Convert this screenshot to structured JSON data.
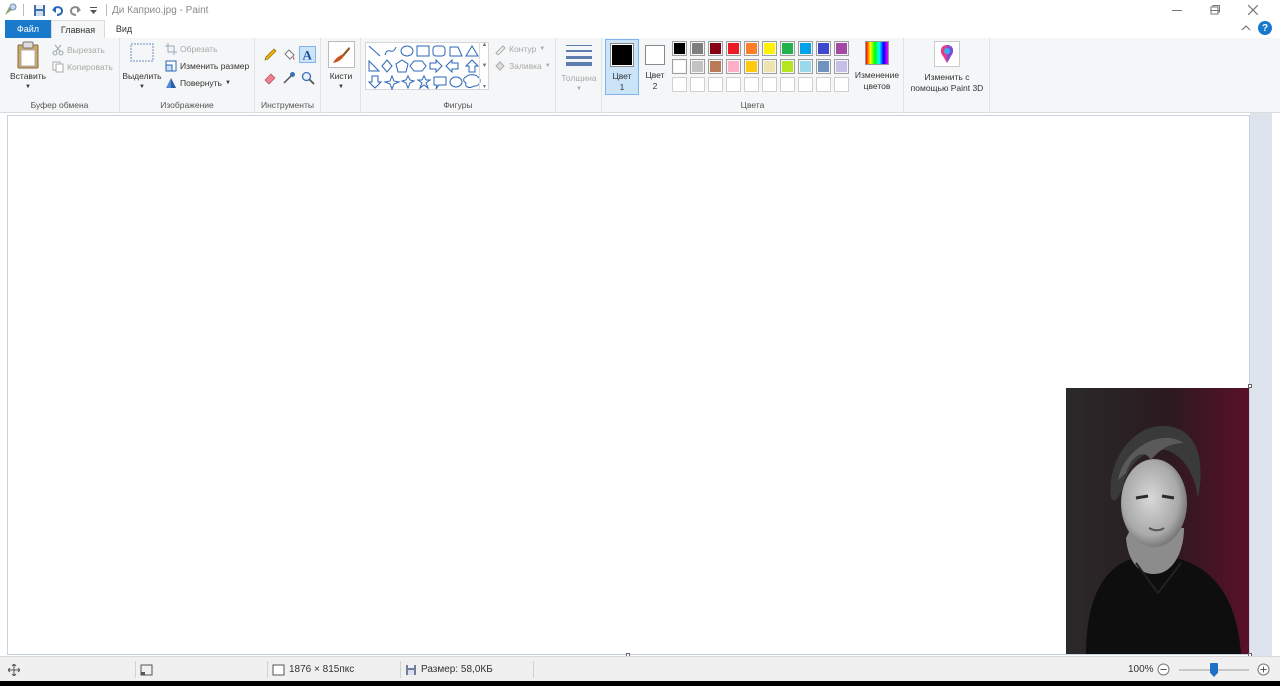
{
  "window": {
    "title": "Ди Каприо.jpg - Paint",
    "minimize_icon": "minimize-icon",
    "restore_icon": "restore-icon",
    "close_icon": "close-icon"
  },
  "tabs": {
    "file": "Файл",
    "home": "Главная",
    "view": "Вид"
  },
  "clipboard": {
    "paste": "Вставить",
    "cut": "Вырезать",
    "copy": "Копировать",
    "group": "Буфер обмена"
  },
  "image": {
    "select": "Выделить",
    "crop": "Обрезать",
    "resize": "Изменить размер",
    "rotate": "Повернуть",
    "group": "Изображение"
  },
  "tools": {
    "group": "Инструменты"
  },
  "brushes": {
    "label": "Кисти"
  },
  "shapes": {
    "outline": "Контур",
    "fill": "Заливка",
    "group": "Фигуры"
  },
  "size": {
    "label": "Толщина"
  },
  "colors": {
    "color1_line1": "Цвет",
    "color1_line2": "1",
    "color2_line1": "Цвет",
    "color2_line2": "2",
    "edit_line1": "Изменение",
    "edit_line2": "цветов",
    "group": "Цвета",
    "color1_value": "#000000",
    "color2_value": "#ffffff",
    "palette_row1": [
      "#000000",
      "#7f7f7f",
      "#880015",
      "#ed1c24",
      "#ff7f27",
      "#fff200",
      "#22b14c",
      "#00a2e8",
      "#3f48cc",
      "#a349a4"
    ],
    "palette_row2": [
      "#ffffff",
      "#c3c3c3",
      "#b97a57",
      "#ffaec9",
      "#ffc90e",
      "#efe4b0",
      "#b5e61d",
      "#99d9ea",
      "#7092be",
      "#c8bfe7"
    ]
  },
  "paint3d": {
    "line1": "Изменить с",
    "line2": "помощью Paint 3D"
  },
  "status": {
    "dimensions": "1876 × 815пкс",
    "size": "Размер: 58,0КБ",
    "zoom": "100%",
    "zoom_level": 1.0
  }
}
